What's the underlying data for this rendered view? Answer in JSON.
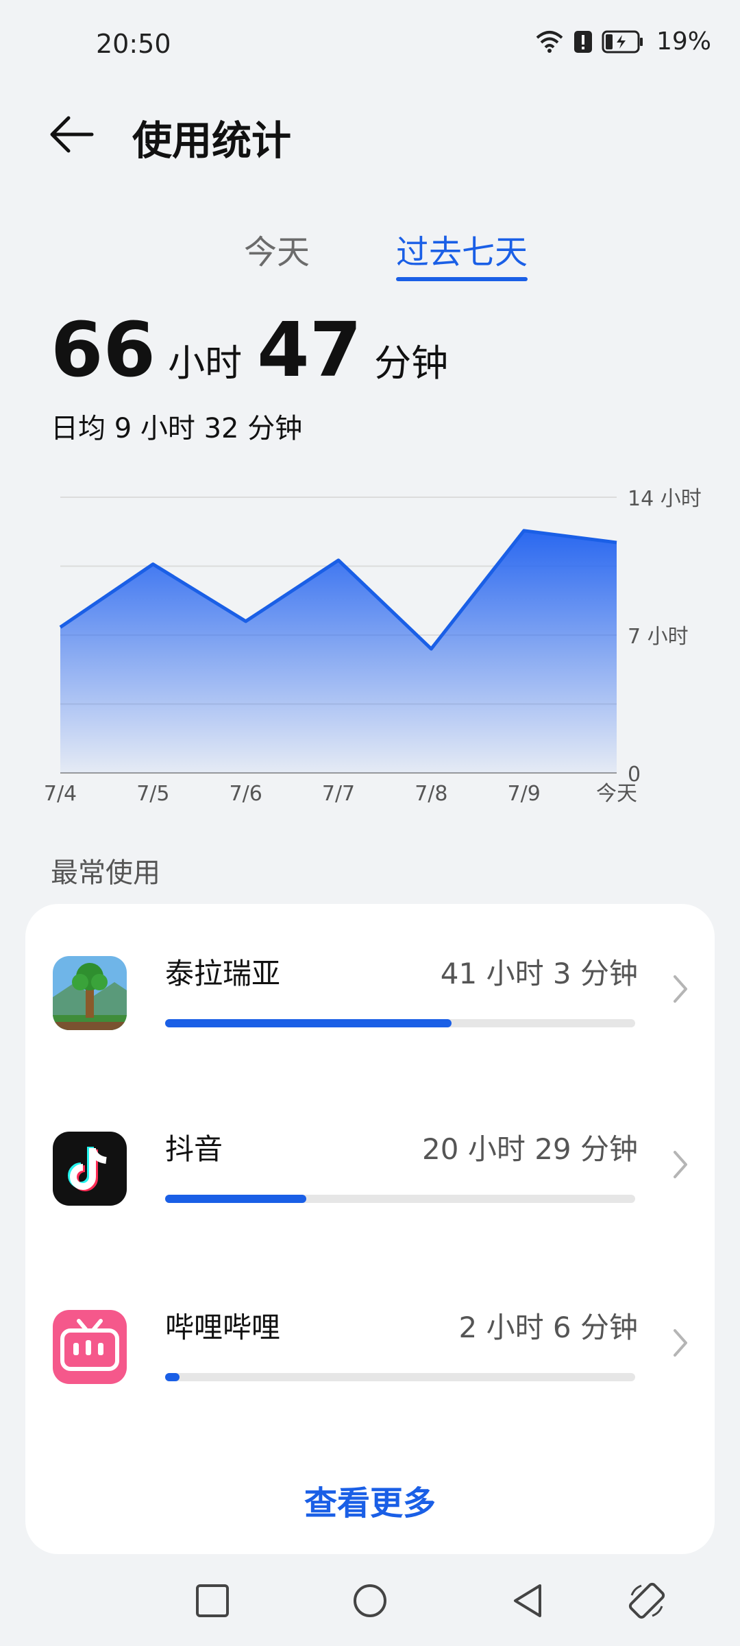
{
  "status": {
    "time": "20:50",
    "battery": "19%"
  },
  "header": {
    "title": "使用统计"
  },
  "tabs": [
    {
      "label": "今天",
      "selected": false
    },
    {
      "label": "过去七天",
      "selected": true
    }
  ],
  "summary": {
    "hours": "66",
    "hours_unit": "小时",
    "minutes": "47",
    "minutes_unit": "分钟",
    "average": "日均 9 小时 32 分钟"
  },
  "chart_data": {
    "type": "area",
    "categories": [
      "7/4",
      "7/5",
      "7/6",
      "7/7",
      "7/8",
      "7/9",
      "今天"
    ],
    "values": [
      7.4,
      10.6,
      7.7,
      10.8,
      6.3,
      12.3,
      11.7
    ],
    "y_ticks": [
      "0",
      "7 小时",
      "14 小时"
    ],
    "ylim": [
      0,
      14
    ],
    "grid": true,
    "color": "#1a5fe6"
  },
  "most_used": {
    "label": "最常使用",
    "apps": [
      {
        "name": "泰拉瑞亚",
        "time": "41 小时 3 分钟",
        "share": 0.61,
        "icon": "terraria-icon"
      },
      {
        "name": "抖音",
        "time": "20 小时 29 分钟",
        "share": 0.3,
        "icon": "douyin-icon"
      },
      {
        "name": "哔哩哔哩",
        "time": "2 小时 6 分钟",
        "share": 0.03,
        "icon": "bilibili-icon"
      }
    ],
    "see_more": "查看更多"
  },
  "colors": {
    "accent": "#1a5fe6",
    "background": "#f1f3f5",
    "card": "#ffffff"
  }
}
